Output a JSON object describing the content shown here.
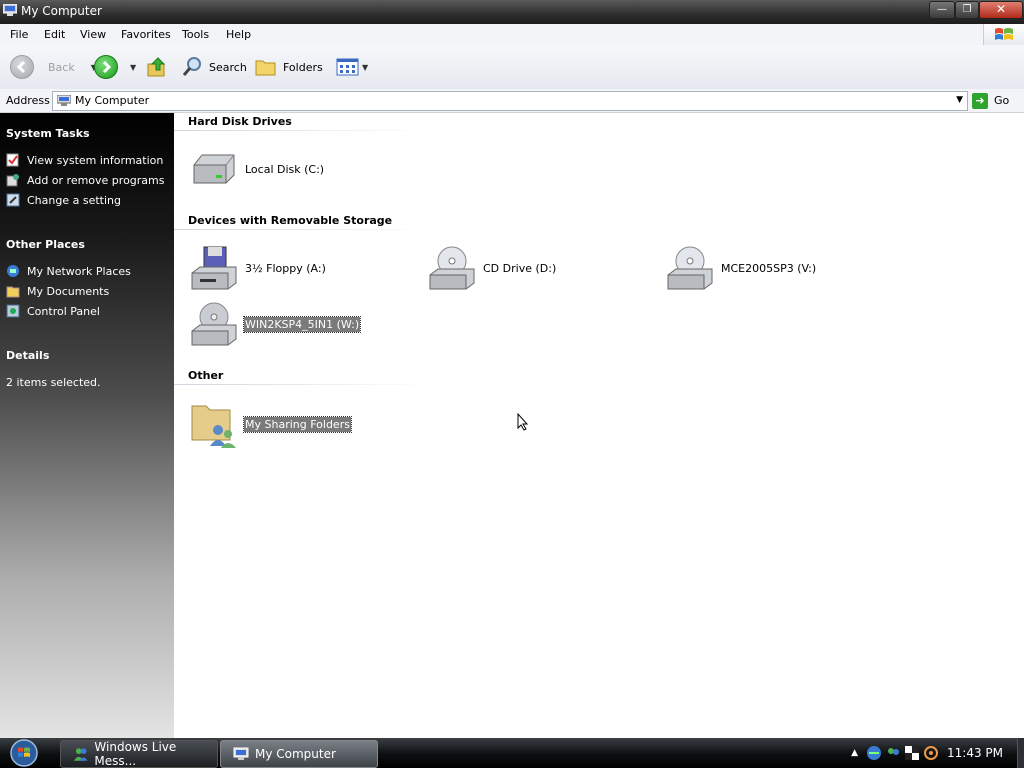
{
  "window": {
    "title": "My Computer"
  },
  "menu": [
    "File",
    "Edit",
    "View",
    "Favorites",
    "Tools",
    "Help"
  ],
  "toolbar": {
    "back_label": "Back",
    "search_label": "Search",
    "folders_label": "Folders"
  },
  "address": {
    "label": "Address",
    "value": "My Computer",
    "go_label": "Go"
  },
  "left_pane": {
    "system_tasks": {
      "title": "System Tasks",
      "items": [
        "View system information",
        "Add or remove programs",
        "Change a setting"
      ]
    },
    "other_places": {
      "title": "Other Places",
      "items": [
        "My Network Places",
        "My Documents",
        "Control Panel"
      ]
    },
    "details": {
      "title": "Details",
      "text": "2 items selected."
    }
  },
  "content": {
    "hard_disk": {
      "title": "Hard Disk Drives",
      "items": [
        {
          "label": "Local Disk (C:)",
          "icon": "hard-disk-icon"
        }
      ]
    },
    "removable": {
      "title": "Devices with Removable Storage",
      "items": [
        {
          "label": "3½ Floppy (A:)",
          "icon": "floppy-drive-icon"
        },
        {
          "label": "CD Drive (D:)",
          "icon": "cd-drive-icon"
        },
        {
          "label": "MCE2005SP3 (V:)",
          "icon": "cd-drive-icon"
        },
        {
          "label": "WIN2KSP4_5IN1 (W:)",
          "icon": "cd-drive-icon",
          "selected": true
        }
      ]
    },
    "other": {
      "title": "Other",
      "items": [
        {
          "label": "My Sharing Folders",
          "icon": "sharing-folder-icon",
          "selected": true
        }
      ]
    }
  },
  "taskbar": {
    "tasks": [
      {
        "label": "Windows Live Mess...",
        "active": false
      },
      {
        "label": "My Computer",
        "active": true
      }
    ],
    "clock": "11:43 PM"
  }
}
